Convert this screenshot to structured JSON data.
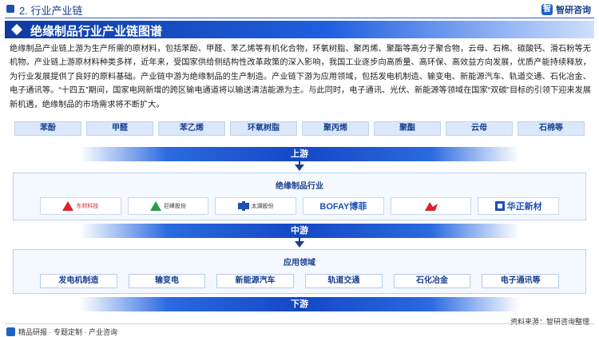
{
  "header": {
    "section_title": "2. 行业产业链",
    "brand_name": "智研咨询",
    "brand_logo_text": "智",
    "page_title": "绝缘制品行业产业链图谱"
  },
  "intro": "绝缘制品产业链上游为生产所需的原材料，包括苯酚、甲醛、苯乙烯等有机化合物，环氧树脂、聚丙烯、聚酯等高分子聚合物，云母、石棉、碳酸钙、滑石粉等无机物。产业链上游原材料种类多样，近年来，受国家供给侧结构性改革政策的深入影响，我国工业逐步向高质量、高环保、高效益方向发展，优质产能持续释放，为行业发展提供了良好的原料基础。产业链中游为绝缘制品的生产制造。产业链下游为应用领域，包括发电机制造、输变电、新能源汽车、轨道交通、石化冶金、电子通讯等。“十四五”期间，国家电网新增的跨区输电通道将以输送清洁能源为主。与此同时，电子通讯、光伏、新能源等领域在国家“双碳”目标的引领下迎来发展新机遇，绝缘制品的市场需求将不断扩大。",
  "upstream": {
    "label": "上游",
    "materials": [
      "苯酚",
      "甲醛",
      "苯乙烯",
      "环氧树脂",
      "聚丙烯",
      "聚酯",
      "云母",
      "石棉等"
    ]
  },
  "midstream": {
    "label": "中游",
    "heading": "绝缘制品行业",
    "companies": [
      {
        "name": "东材科技",
        "style": "red-mark"
      },
      {
        "name": "巨峰股份",
        "style": "green-mark"
      },
      {
        "name": "太湖股份",
        "style": "blue-mark"
      },
      {
        "name": "BOFAY博菲",
        "style": "wordmark"
      },
      {
        "name": "",
        "style": "red-figure"
      },
      {
        "name": "华正新材",
        "style": "hz-mark"
      }
    ]
  },
  "downstream": {
    "label": "下游",
    "heading": "应用领域",
    "applications": [
      "发电机制造",
      "输变电",
      "新能源汽车",
      "轨道交通",
      "石化冶金",
      "电子通讯等"
    ]
  },
  "footer": {
    "left": "精品研报 · 专题定制 · 产业咨询",
    "source": "资料来源：智研咨询整理"
  },
  "colors": {
    "primary": "#1447c4",
    "accent_light": "#dbe8fb",
    "text_blue": "#1a3f8f"
  }
}
